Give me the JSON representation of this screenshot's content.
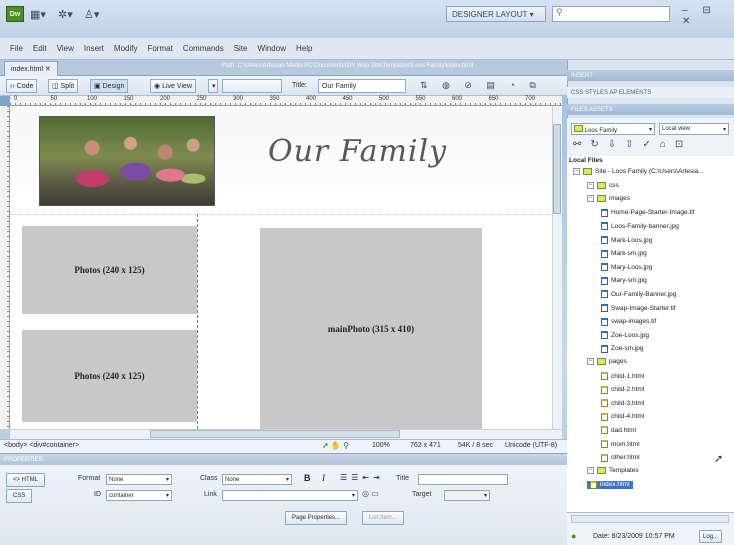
{
  "app": {
    "logo_text": "Dw",
    "layout_label": "DESIGNER LAYOUT",
    "window_controls": "– ⊟ ✕"
  },
  "menu": [
    "File",
    "Edit",
    "View",
    "Insert",
    "Modify",
    "Format",
    "Commands",
    "Site",
    "Window",
    "Help"
  ],
  "document": {
    "tab_label": "index.html ✕",
    "path": "Path: C:\\Users\\Artesian Media PC\\Documents\\2IY Web Site\\Templates\\Loos Family\\index.html",
    "toolbar": {
      "code": "Code",
      "split": "Split",
      "design": "Design",
      "live_view": "Live View",
      "title_label": "Title:",
      "title_value": "Our Family"
    },
    "ruler_ticks": [
      "0",
      "50",
      "100",
      "150",
      "200",
      "250",
      "300",
      "350",
      "400",
      "450",
      "500",
      "550",
      "600",
      "650",
      "700"
    ]
  },
  "canvas": {
    "banner_title": "Our Family",
    "box1": "Photos (240 x 125)",
    "box2": "Photos (240 x 125)",
    "box3": "mainPhoto (315 x 410)"
  },
  "status": {
    "tag_selector": "<body> <div#container>",
    "zoom": "100%",
    "size": "762 x 471",
    "download": "54K / 8 sec",
    "encoding": "Unicode (UTF-8)"
  },
  "properties": {
    "header": "PROPERTIES",
    "html_btn": "<> HTML",
    "css_btn": "CSS",
    "format_label": "Format",
    "format_value": "None",
    "class_label": "Class",
    "class_value": "None",
    "id_label": "ID",
    "id_value": "container",
    "link_label": "Link",
    "title_label": "Title",
    "target_label": "Target",
    "page_properties": "Page Properties...",
    "list_item": "List Item..."
  },
  "panels": {
    "insert": "INSERT",
    "css_tabs": "CSS STYLES   AP ELEMENTS",
    "files_tabs": "FILES   ASSETS",
    "site_select": "Loos Family",
    "view_select": "Local view",
    "local_files": "Local Files",
    "date_label": "Date: 8/23/2009 10:57 PM",
    "log_button": "Log..."
  },
  "tree": [
    {
      "label": "Site - Loos Family (C:\\Users\\Artesia...",
      "type": "folder",
      "depth": 0
    },
    {
      "label": "css",
      "type": "folder",
      "depth": 1
    },
    {
      "label": "images",
      "type": "folder",
      "depth": 1
    },
    {
      "label": "Home-Page-Starter-Image.tif",
      "type": "file",
      "depth": 2
    },
    {
      "label": "Loos-Family-banner.jpg",
      "type": "file",
      "depth": 2
    },
    {
      "label": "Mark-Loos.jpg",
      "type": "file",
      "depth": 2
    },
    {
      "label": "Mark-sm.jpg",
      "type": "file",
      "depth": 2
    },
    {
      "label": "Mary-Loos.jpg",
      "type": "file",
      "depth": 2
    },
    {
      "label": "Mary-sm.jpg",
      "type": "file",
      "depth": 2
    },
    {
      "label": "Our-Family-Banner.jpg",
      "type": "file",
      "depth": 2
    },
    {
      "label": "Swap-Image-Starter.tif",
      "type": "file",
      "depth": 2
    },
    {
      "label": "swap-images.tif",
      "type": "file",
      "depth": 2
    },
    {
      "label": "Zoe-Loos.jpg",
      "type": "file",
      "depth": 2
    },
    {
      "label": "Zoe-sm.jpg",
      "type": "file",
      "depth": 2
    },
    {
      "label": "pages",
      "type": "folder",
      "depth": 1
    },
    {
      "label": "child-1.html",
      "type": "html",
      "depth": 2
    },
    {
      "label": "child-2.html",
      "type": "html",
      "depth": 2
    },
    {
      "label": "child-3.html",
      "type": "html",
      "depth": 2
    },
    {
      "label": "child-4.html",
      "type": "html",
      "depth": 2
    },
    {
      "label": "dad.html",
      "type": "html",
      "depth": 2
    },
    {
      "label": "mom.html",
      "type": "html",
      "depth": 2
    },
    {
      "label": "other.html",
      "type": "html",
      "depth": 2
    },
    {
      "label": "Templates",
      "type": "folder",
      "depth": 1
    },
    {
      "label": "index.html",
      "type": "html",
      "depth": 1,
      "selected": true
    }
  ]
}
